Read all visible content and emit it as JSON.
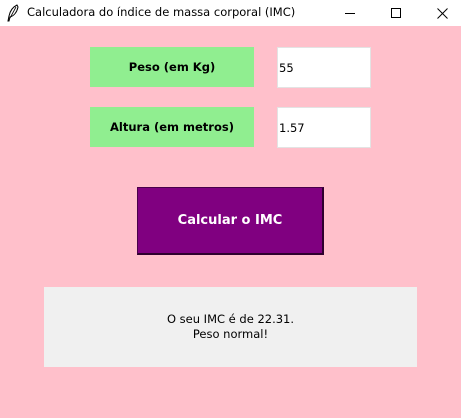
{
  "window": {
    "title": "Calculadora do índice de massa corporal (IMC)",
    "app_icon": "feather-icon",
    "controls": {
      "minimize_icon": "minimize-icon",
      "maximize_icon": "maximize-icon",
      "close_icon": "close-icon"
    }
  },
  "form": {
    "peso_label": "Peso (em Kg)",
    "peso_value": "55",
    "altura_label": "Altura (em metros)",
    "altura_value": "1.57"
  },
  "actions": {
    "calcular_label": "Calcular o IMC"
  },
  "result": {
    "line1": "O seu IMC é de 22.31.",
    "line2": "Peso normal!"
  },
  "colors": {
    "background": "#ffc0cb",
    "label_background": "#90ee90",
    "button_background": "#800080",
    "button_text": "#ffffff",
    "result_background": "#f0f0f0"
  }
}
